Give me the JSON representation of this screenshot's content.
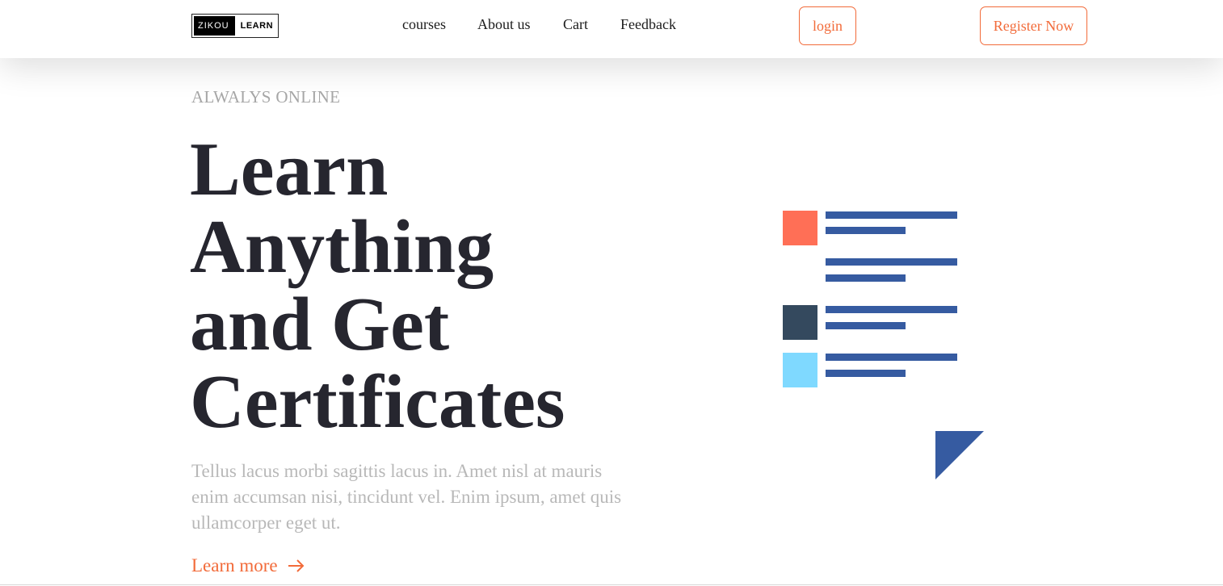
{
  "header": {
    "logo": {
      "left_text": "ZIKOU",
      "right_text": "LEARN"
    },
    "nav": [
      "courses",
      "About us",
      "Cart",
      "Feedback"
    ],
    "login_label": "login",
    "register_label": "Register Now"
  },
  "hero": {
    "tagline": "ALWALYS ONLINE",
    "title_lines": [
      "Learn",
      "Anything",
      "and Get",
      "Certificates"
    ],
    "description": "Tellus lacus morbi sagittis lacus in. Amet nisl at mauris enim accumsan nisi, tincidunt vel. Enim ipsum, amet quis ullamcorper eget ut.",
    "cta_label": "Learn more"
  },
  "colors": {
    "accent": "#f26b3a",
    "title": "#26262f",
    "muted": "#b8b8b8",
    "illustration_orange": "#ff6f56",
    "illustration_navy": "#34495e",
    "illustration_cyan": "#7fd9ff",
    "illustration_blue": "#365ba1"
  },
  "icons": {
    "cta_arrow": "arrow-right-icon"
  }
}
